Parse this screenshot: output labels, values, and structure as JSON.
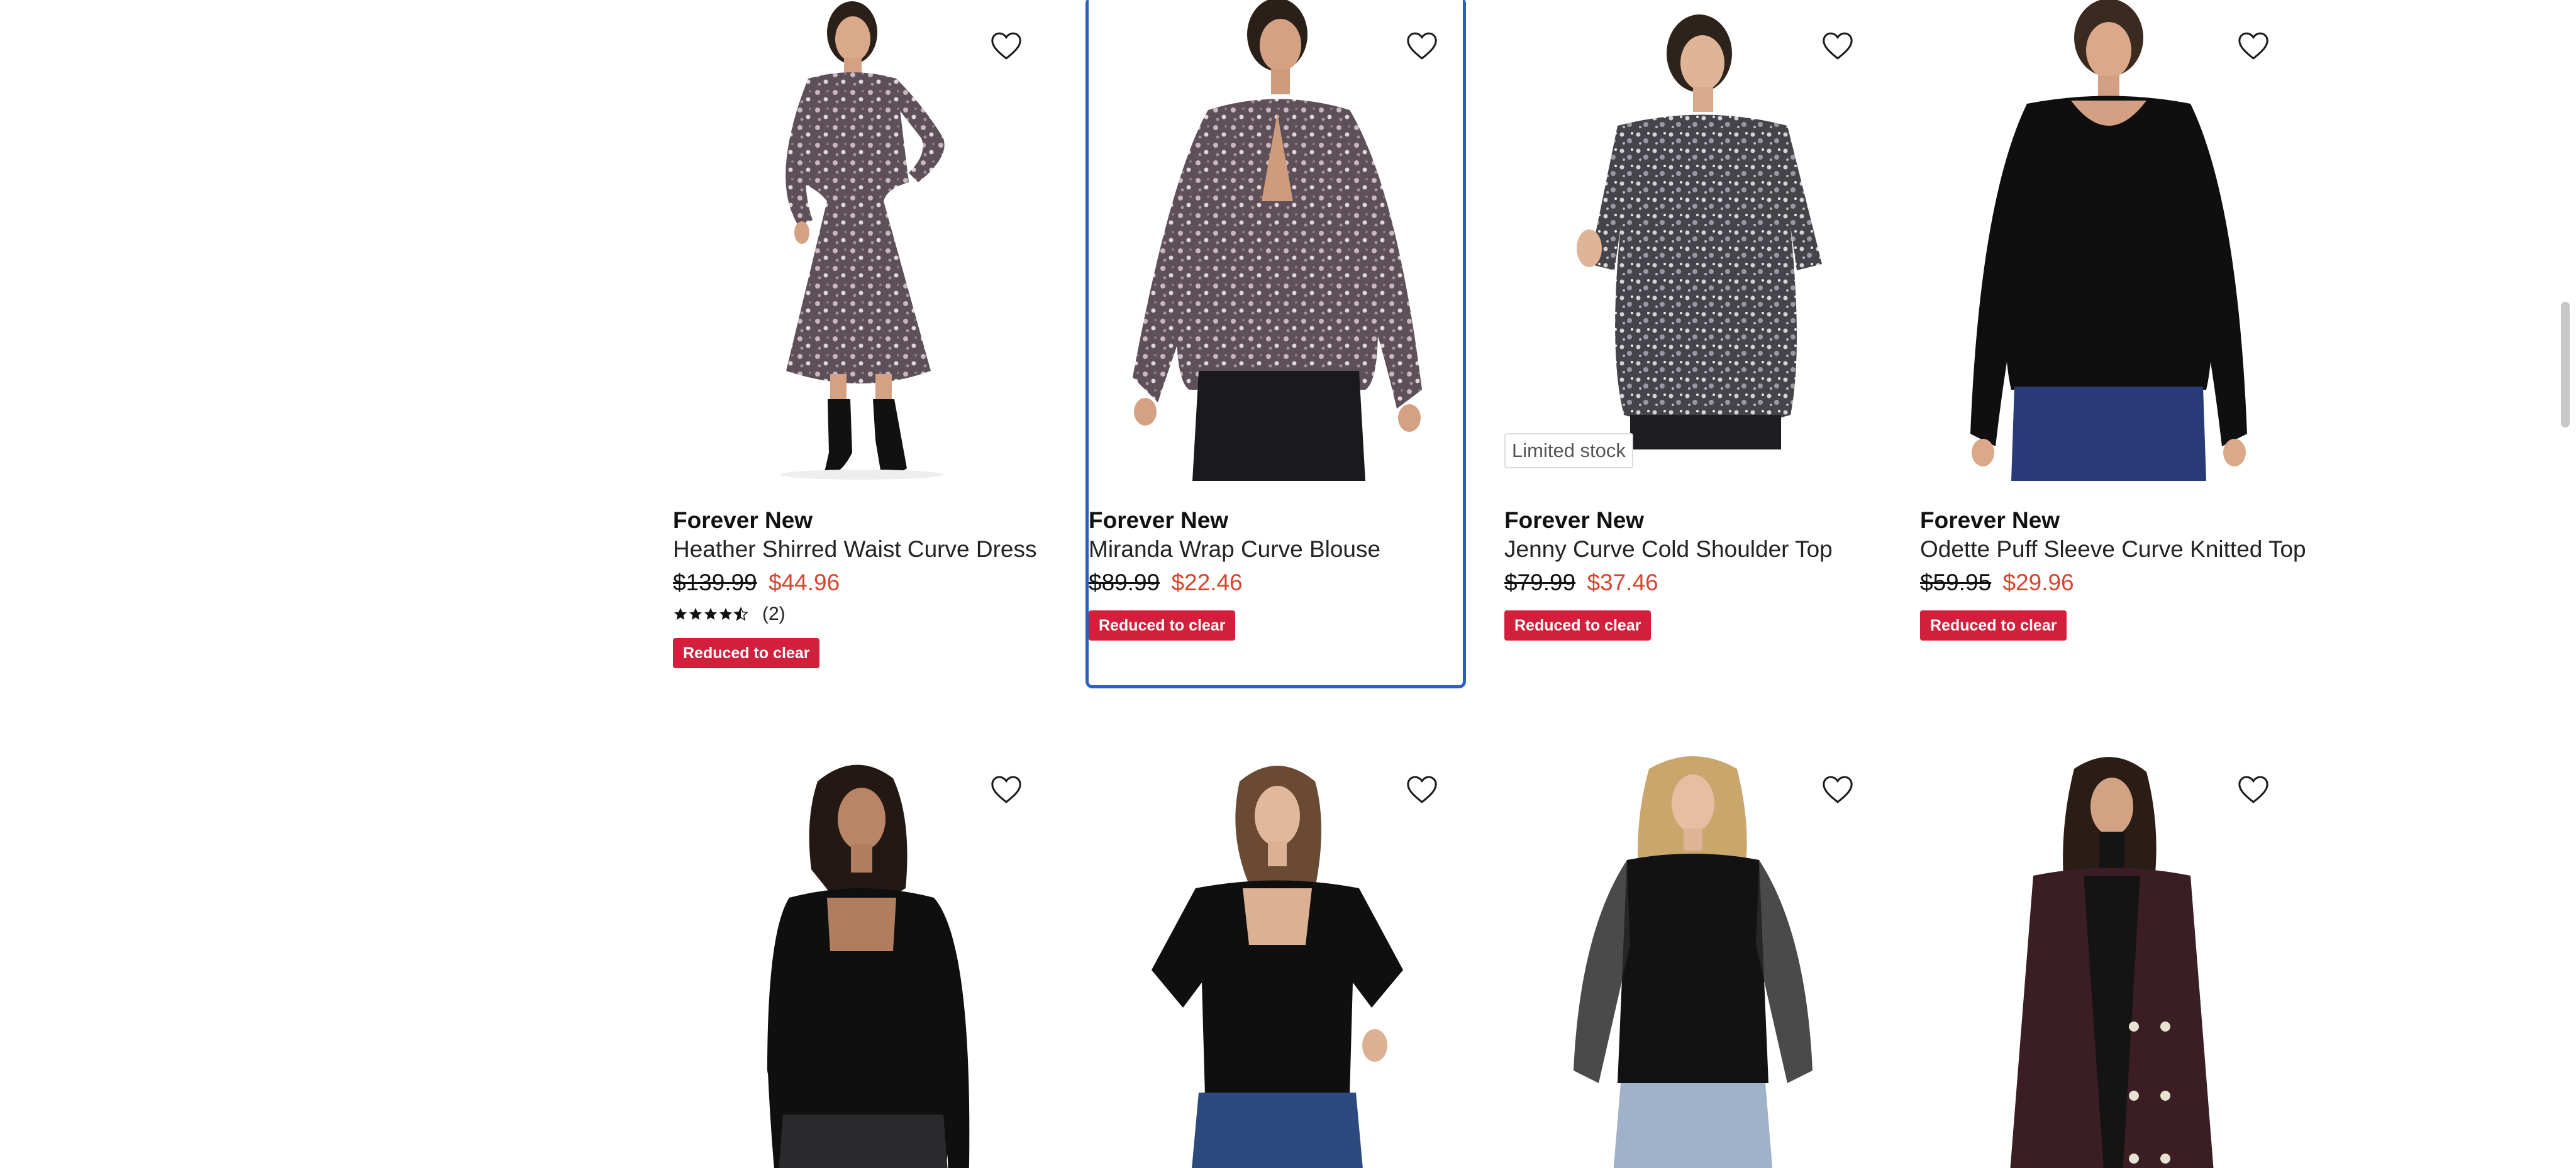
{
  "colors": {
    "sale_price": "#d8452e",
    "promo_badge": "#d21f3c",
    "focus_outline": "#2b5fc0"
  },
  "products_row1": [
    {
      "brand": "Forever New",
      "title": "Heather Shirred Waist Curve Dress",
      "was_price": "$139.99",
      "price": "$44.96",
      "rating_stars": 4.5,
      "rating_count": "(2)",
      "promo": "Reduced to clear",
      "wishlist_icon": "heart-outline-icon"
    },
    {
      "brand": "Forever New",
      "title": "Miranda Wrap Curve Blouse",
      "was_price": "$89.99",
      "price": "$22.46",
      "promo": "Reduced to clear",
      "wishlist_icon": "heart-outline-icon"
    },
    {
      "brand": "Forever New",
      "title": "Jenny Curve Cold Shoulder Top",
      "was_price": "$79.99",
      "price": "$37.46",
      "stock_badge": "Limited stock",
      "promo": "Reduced to clear",
      "wishlist_icon": "heart-outline-icon"
    },
    {
      "brand": "Forever New",
      "title": "Odette Puff Sleeve Curve Knitted Top",
      "was_price": "$59.95",
      "price": "$29.96",
      "promo": "Reduced to clear",
      "wishlist_icon": "heart-outline-icon"
    }
  ],
  "products_row2": [
    {
      "wishlist_icon": "heart-outline-icon"
    },
    {
      "wishlist_icon": "heart-outline-icon"
    },
    {
      "wishlist_icon": "heart-outline-icon"
    },
    {
      "wishlist_icon": "heart-outline-icon"
    }
  ]
}
